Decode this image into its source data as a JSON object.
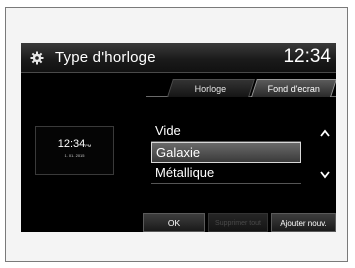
{
  "header": {
    "icon": "gear-icon",
    "title": "Type d'horloge",
    "time": "12:34"
  },
  "tabs": [
    {
      "label": "Horloge",
      "active": false
    },
    {
      "label": "Fond d'ecran",
      "active": true
    }
  ],
  "preview": {
    "time": "12:34",
    "ampm": "PM",
    "date": "1. 01. 2015"
  },
  "list": {
    "items": [
      {
        "label": "Vide",
        "selected": false
      },
      {
        "label": "Galaxie",
        "selected": true
      },
      {
        "label": "Métallique",
        "selected": false
      }
    ]
  },
  "buttons": {
    "ok": "OK",
    "delete_all": "Supprimer tout",
    "add_new": "Ajouter nouv."
  },
  "colors": {
    "screen_bg": "#000000",
    "selected_border": "#d8d8d8",
    "disabled_text": "#4a4a4a"
  }
}
